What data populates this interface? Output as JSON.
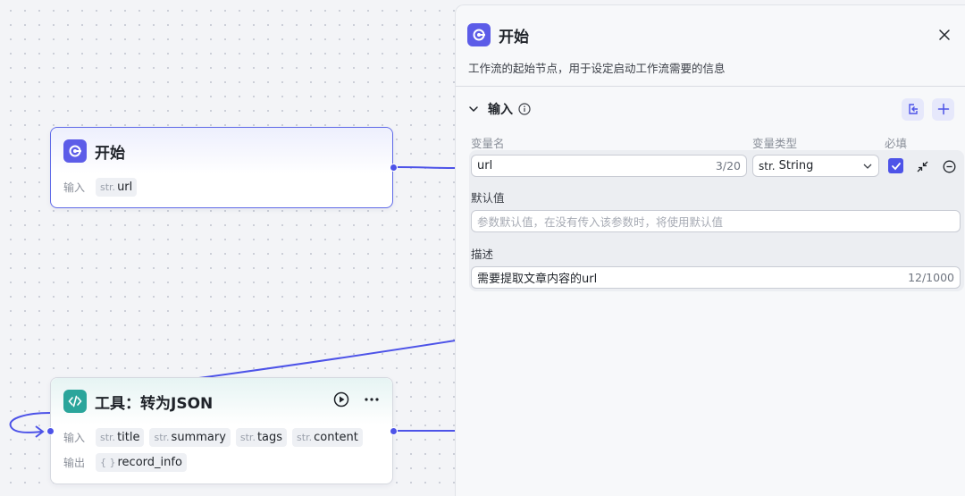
{
  "start_node": {
    "title": "开始",
    "input_label": "输入",
    "inputs": [
      {
        "type": "str.",
        "name": "url"
      }
    ]
  },
  "tool_node": {
    "title": "工具：转为JSON",
    "input_label": "输入",
    "inputs": [
      {
        "type": "str.",
        "name": "title"
      },
      {
        "type": "str.",
        "name": "summary"
      },
      {
        "type": "str.",
        "name": "tags"
      },
      {
        "type": "str.",
        "name": "content"
      }
    ],
    "output_label": "输出",
    "outputs": [
      {
        "type": "{ }",
        "name": "record_info"
      }
    ]
  },
  "panel": {
    "title": "开始",
    "description": "工作流的起始节点，用于设定启动工作流需要的信息",
    "section_title": "输入",
    "columns": {
      "name": "变量名",
      "type": "变量类型",
      "required": "必填"
    },
    "variable": {
      "name": "url",
      "name_count": "3/20",
      "type_prefix": "str.",
      "type": "String",
      "required": true,
      "default_label": "默认值",
      "default_placeholder": "参数默认值，在没有传入该参数时，将使用默认值",
      "desc_label": "描述",
      "desc_value": "需要提取文章内容的url",
      "desc_count": "12/1000"
    }
  },
  "colors": {
    "accent": "#4d53e8",
    "start_icon": "#5c5ce8",
    "tool_icon": "#2aa59b"
  },
  "icons": {
    "start": "start-node-icon",
    "tool": "code-icon",
    "run": "play-circle-icon",
    "more": "more-icon",
    "close": "close-icon",
    "collapse": "chevron-down-icon",
    "info": "info-icon",
    "import": "import-icon",
    "add": "plus-icon",
    "shrink": "shrink-icon",
    "remove": "minus-circle-icon"
  }
}
